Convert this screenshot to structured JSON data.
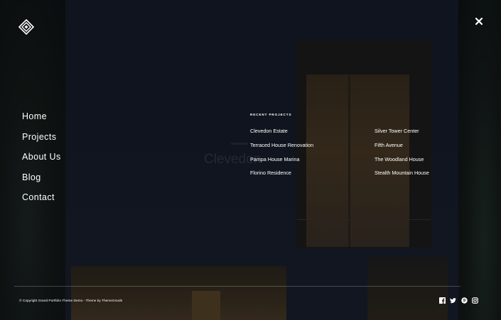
{
  "nav": {
    "items": [
      {
        "label": "Home"
      },
      {
        "label": "Projects"
      },
      {
        "label": "About Us"
      },
      {
        "label": "Blog"
      },
      {
        "label": "Contact"
      }
    ]
  },
  "background": {
    "ghost_title": "Clevedon"
  },
  "recent_projects": {
    "heading": "RECENT PROJECTS",
    "column_a": [
      {
        "label": "Clevedon Estate"
      },
      {
        "label": "Terraced House Renovation"
      },
      {
        "label": "Pampa House Marina"
      },
      {
        "label": "Florino Residence"
      }
    ],
    "column_b": [
      {
        "label": "Silver Tower Center"
      },
      {
        "label": "Fifth Avenue"
      },
      {
        "label": "The Woodland House"
      },
      {
        "label": "Stealth Mountain House"
      }
    ]
  },
  "footer": {
    "copyright": "© Copyright Grand Portfolio Theme Demo - Theme by ThemeGoods",
    "social": [
      {
        "icon": "facebook-icon"
      },
      {
        "icon": "twitter-icon"
      },
      {
        "icon": "pinterest-icon"
      },
      {
        "icon": "instagram-icon"
      }
    ]
  },
  "icons": {
    "logo": "diamond-logo-icon",
    "close": "close-icon"
  },
  "colors": {
    "text": "#ffffff",
    "overlay": "#0d0f14"
  }
}
